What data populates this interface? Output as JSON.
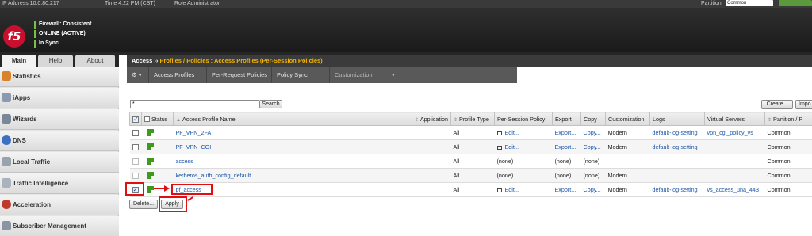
{
  "topbar": {
    "ip": "IP Address   10.0.80.217",
    "time": "Time   4:22 PM (CST)",
    "role": "Role   Administrator",
    "partition_label": "Partition",
    "partition_value": "Common"
  },
  "header": {
    "logo": "f5",
    "status": [
      "Firewall: Consistent",
      "ONLINE (ACTIVE)",
      "In Sync"
    ]
  },
  "nav_tabs": [
    "Main",
    "Help",
    "About"
  ],
  "sidebar": {
    "items": [
      {
        "label": "Statistics",
        "icon": "statistics-icon"
      },
      {
        "label": "iApps",
        "icon": "iapps-icon"
      },
      {
        "label": "Wizards",
        "icon": "wizards-icon"
      },
      {
        "label": "DNS",
        "icon": "dns-icon"
      },
      {
        "label": "Local Traffic",
        "icon": "local-traffic-icon"
      },
      {
        "label": "Traffic Intelligence",
        "icon": "traffic-intelligence-icon"
      },
      {
        "label": "Acceleration",
        "icon": "acceleration-icon"
      },
      {
        "label": "Subscriber Management",
        "icon": "subscriber-management-icon"
      }
    ]
  },
  "breadcrumb": {
    "root": "Access",
    "sep": " ›› ",
    "path": "Profiles / Policies : Access Profiles (Per-Session Policies)"
  },
  "toolbar": {
    "gear": "⚙ ▾",
    "items": [
      "Access Profiles",
      "Per-Request Policies",
      "Policy Sync",
      "Customization"
    ],
    "dropdown": "▾"
  },
  "search": {
    "value": "*",
    "button": "Search"
  },
  "actions": {
    "create": "Create...",
    "import": "Impo"
  },
  "table": {
    "columns": [
      "Status",
      "Access Profile Name",
      "Application",
      "Profile Type",
      "Per-Session Policy",
      "Export",
      "Copy",
      "Customization",
      "Logs",
      "Virtual Servers",
      "Partition / P"
    ],
    "rows": [
      {
        "name": "PF_VPN_2FA",
        "type": "All",
        "policy": "Edit...",
        "export": "Export...",
        "copy": "Copy...",
        "custom": "Modern",
        "logs": "default-log-setting",
        "vs": "vpn_cgi_policy_vs",
        "partition": "Common"
      },
      {
        "name": "PF_VPN_CGI",
        "type": "All",
        "policy": "Edit...",
        "export": "Export...",
        "copy": "Copy...",
        "custom": "Modern",
        "logs": "default-log-setting",
        "vs": "",
        "partition": "Common"
      },
      {
        "name": "access",
        "type": "All",
        "policy": "(none)",
        "export": "(none)",
        "copy": "(none)",
        "custom": "",
        "logs": "",
        "vs": "",
        "partition": "Common"
      },
      {
        "name": "kerberos_auth_config_default",
        "type": "All",
        "policy": "(none)",
        "export": "(none)",
        "copy": "(none)",
        "custom": "Modern",
        "logs": "",
        "vs": "",
        "partition": "Common"
      },
      {
        "name": "pf_access",
        "type": "All",
        "policy": "Edit...",
        "export": "Export...",
        "copy": "Copy...",
        "custom": "Modern",
        "logs": "default-log-setting",
        "vs": "vs_access_una_443",
        "partition": "Common"
      }
    ]
  },
  "bottom": {
    "delete": "Delete...",
    "apply": "Apply"
  },
  "colors": {
    "annotation": "#e01010",
    "link": "#1a55a8",
    "breadcrumb_accent": "#f4b400",
    "f5_red": "#c8102e",
    "status_green": "#7ac143"
  }
}
